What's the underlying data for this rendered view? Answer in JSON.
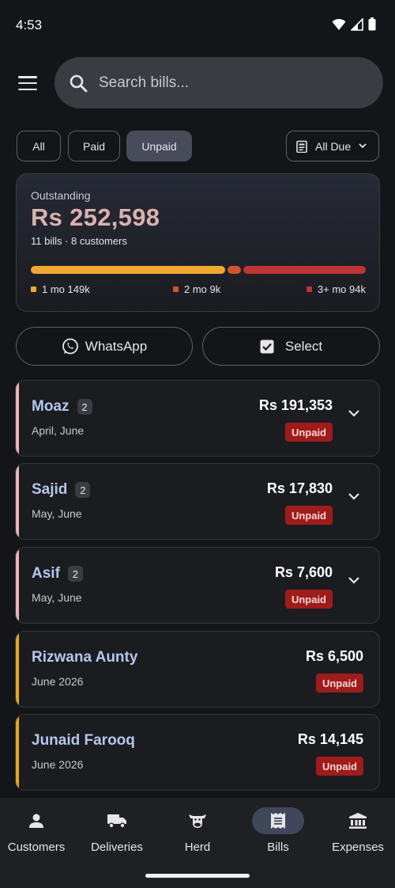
{
  "status_bar": {
    "time": "4:53"
  },
  "search": {
    "placeholder": "Search bills..."
  },
  "filters": {
    "all": "All",
    "paid": "Paid",
    "unpaid": "Unpaid",
    "selected": "Unpaid",
    "due": "All Due"
  },
  "summary": {
    "label": "Outstanding",
    "amount": "Rs 252,598",
    "sub": "11 bills · 8 customers",
    "aging": [
      {
        "label": "1 mo 149k",
        "share": 0.59,
        "color": "#f0a830"
      },
      {
        "label": "2 mo 9k",
        "share": 0.04,
        "color": "#d0552e"
      },
      {
        "label": "3+ mo 94k",
        "share": 0.37,
        "color": "#bf3434"
      }
    ]
  },
  "actions": {
    "whatsapp": "WhatsApp",
    "select": "Select"
  },
  "bills": [
    {
      "name": "Moaz",
      "count": "2",
      "months": "April, June",
      "amount": "Rs 191,353",
      "status": "Unpaid",
      "stripe": "#e8b4b4",
      "expandable": true
    },
    {
      "name": "Sajid",
      "count": "2",
      "months": "May, June",
      "amount": "Rs 17,830",
      "status": "Unpaid",
      "stripe": "#e8b4b4",
      "expandable": true
    },
    {
      "name": "Asif",
      "count": "2",
      "months": "May, June",
      "amount": "Rs 7,600",
      "status": "Unpaid",
      "stripe": "#e8b4b4",
      "expandable": true
    },
    {
      "name": "Rizwana Aunty",
      "count": "",
      "months": "June 2026",
      "amount": "Rs 6,500",
      "status": "Unpaid",
      "stripe": "#e0a81e",
      "expandable": false
    },
    {
      "name": "Junaid Farooq",
      "count": "",
      "months": "June 2026",
      "amount": "Rs 14,145",
      "status": "Unpaid",
      "stripe": "#e0a81e",
      "expandable": false
    }
  ],
  "nav": [
    {
      "label": "Customers",
      "icon": "person-icon"
    },
    {
      "label": "Deliveries",
      "icon": "truck-icon"
    },
    {
      "label": "Herd",
      "icon": "cow-icon"
    },
    {
      "label": "Bills",
      "icon": "receipt-icon",
      "active": true
    },
    {
      "label": "Expenses",
      "icon": "bank-icon"
    }
  ]
}
